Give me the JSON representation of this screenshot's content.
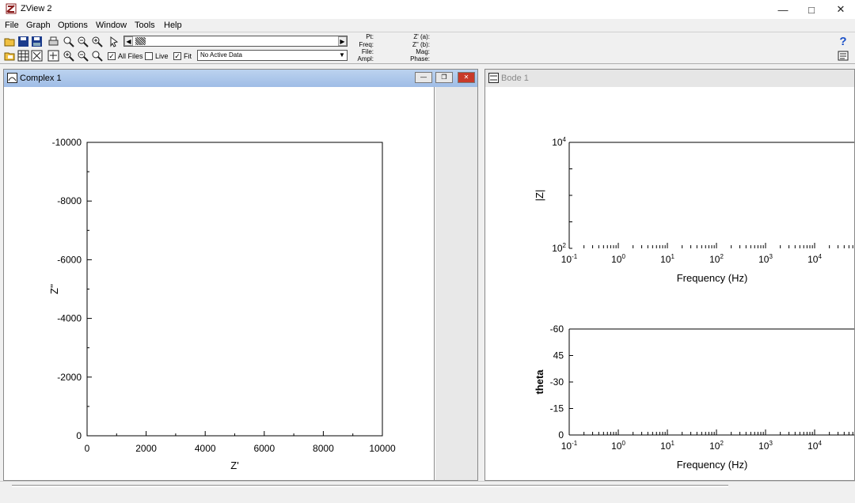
{
  "app": {
    "title": "ZView 2"
  },
  "menu": [
    "File",
    "Graph",
    "Options",
    "Window",
    "Tools",
    "Help"
  ],
  "toolbar": {
    "all_files_label": "All Files",
    "all_files_checked": true,
    "live_label": "Live",
    "live_checked": false,
    "fit_label": "Fit",
    "fit_checked": true,
    "active_data_value": "No Active Data",
    "readout_labels_left": [
      "Pt:",
      "Freq:",
      "File:",
      "Ampl:"
    ],
    "readout_labels_right": [
      "Z' (a):",
      "Z'' (b):",
      "Mag:",
      "Phase:"
    ]
  },
  "windows": {
    "complex": {
      "title": "Complex 1"
    },
    "bode": {
      "title": "Bode 1"
    }
  },
  "chart_data": [
    {
      "type": "scatter",
      "title": "",
      "xlabel": "Z'",
      "ylabel": "Z''",
      "xlim": [
        0,
        10000
      ],
      "ylim": [
        0,
        -10000
      ],
      "xticks": [
        "0",
        "2000",
        "4000",
        "6000",
        "8000",
        "10000"
      ],
      "yticks": [
        "0",
        "-2000",
        "-4000",
        "-6000",
        "-8000",
        "-10000"
      ],
      "series": []
    },
    {
      "type": "line",
      "title": "",
      "xlabel": "Frequency (Hz)",
      "ylabel": "|Z|",
      "xscale": "log",
      "yscale": "log",
      "xticks": [
        "10-1",
        "100",
        "101",
        "102",
        "103",
        "104"
      ],
      "yticks": [
        "102",
        "104"
      ],
      "series": []
    },
    {
      "type": "line",
      "title": "",
      "xlabel": "Frequency (Hz)",
      "ylabel": "theta",
      "xscale": "log",
      "xticks": [
        "10-1",
        "100",
        "101",
        "102",
        "103",
        "104"
      ],
      "yticks": [
        "0",
        "-15",
        "-30",
        "45",
        "-60"
      ],
      "series": []
    }
  ]
}
